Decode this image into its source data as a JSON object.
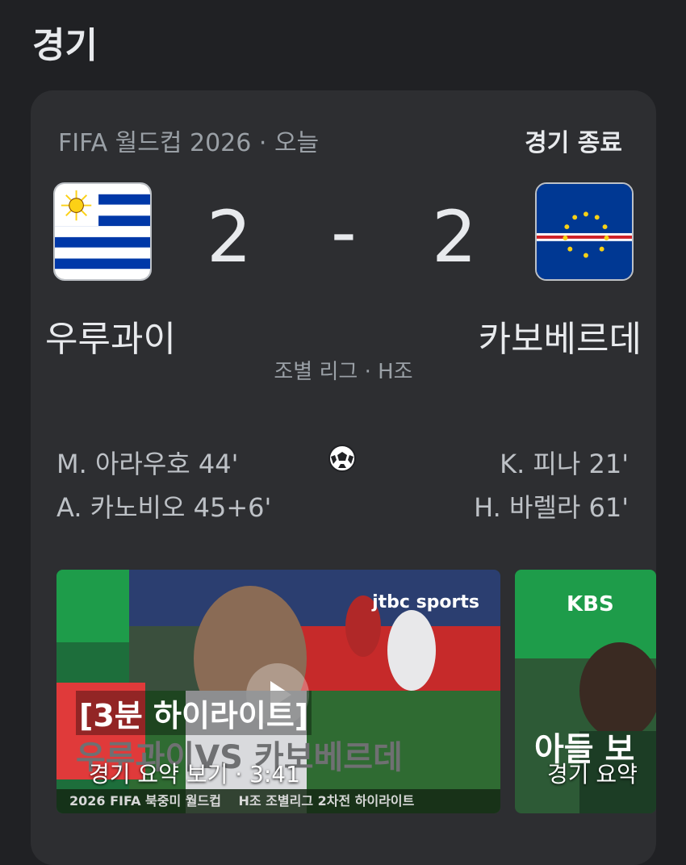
{
  "section_title": "경기",
  "match": {
    "competition": "FIFA 월드컵 2026 · 오늘",
    "status": "경기 종료",
    "home": {
      "name": "우루과이",
      "score": "2",
      "flag_icon": "uruguay-flag-icon"
    },
    "away": {
      "name": "카보베르데",
      "score": "2",
      "flag_icon": "cape-verde-flag-icon"
    },
    "score_separator": "-",
    "stage": "조별 리그 · H조",
    "home_scorers": [
      "M. 아라우호 44'",
      "A. 카노비오 45+6'"
    ],
    "away_scorers": [
      "K. 피나 21'",
      "H. 바렐라 61'"
    ],
    "goal_icon": "soccer-ball-icon"
  },
  "videos": [
    {
      "label": "경기 요약 보기 · 3:41",
      "headline_line1": "[3분 하이라이트]",
      "headline_line2": "우루과이VS 카보베르데",
      "footer_left": "2026 FIFA 북중미 월드컵",
      "footer_right": "H조 조별리그 2차전 하이라이트",
      "broadcaster": "jtbc sports",
      "icon": "play-icon"
    },
    {
      "label": "경기 요약",
      "headline": "아들 보",
      "broadcaster": "KBS"
    }
  ],
  "colors": {
    "background": "#202124",
    "card": "#2d2e31",
    "muted_text": "#9aa0a6",
    "primary_text": "#e8eaed"
  }
}
